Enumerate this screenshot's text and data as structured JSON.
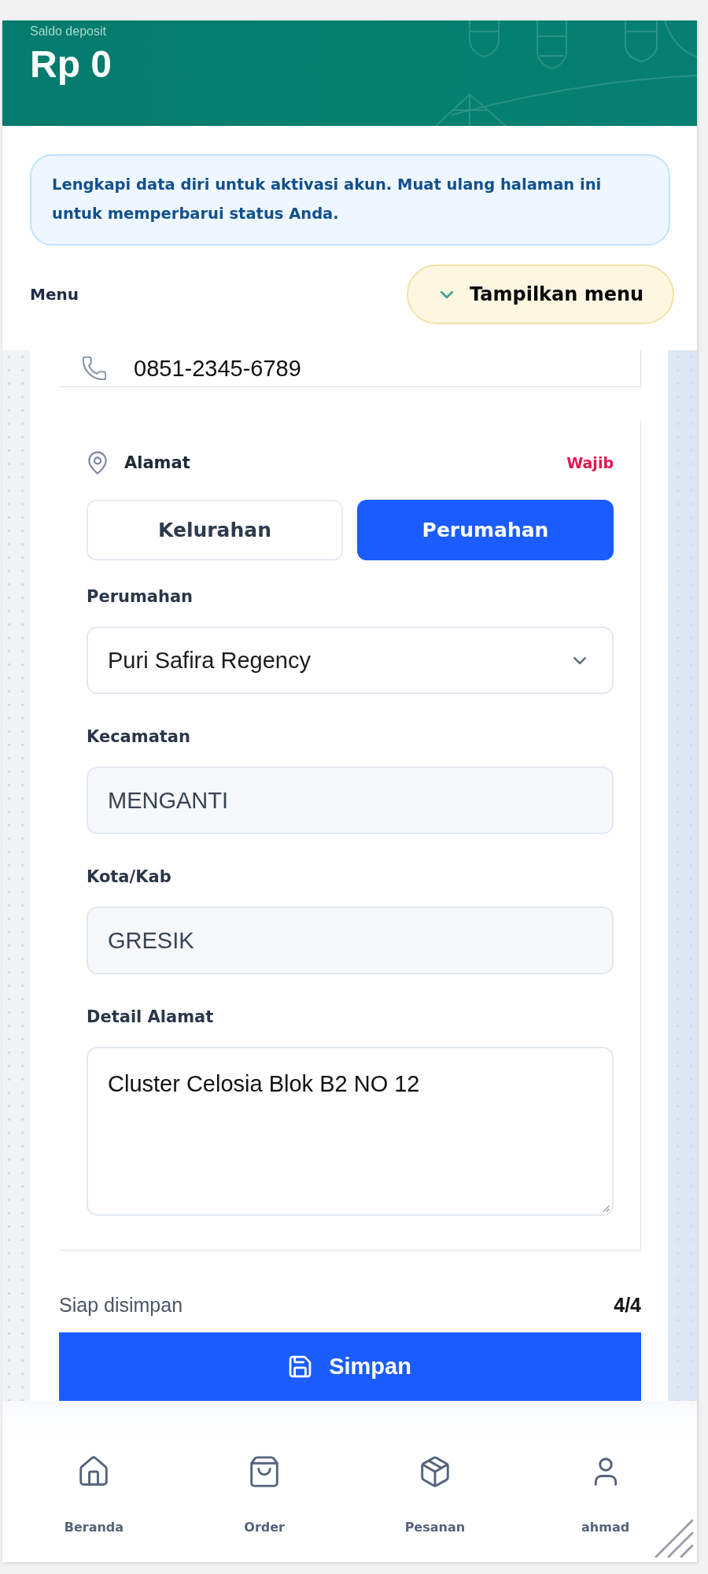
{
  "header": {
    "label": "Saldo deposit",
    "balance": "Rp 0"
  },
  "notice": {
    "text": "Lengkapi data diri untuk aktivasi akun. Muat ulang halaman ini untuk memperbarui status Anda."
  },
  "menu": {
    "label": "Menu",
    "toggle": {
      "label": "Tampilkan menu",
      "expanded": false
    }
  },
  "form": {
    "phone": {
      "value": "0851-2345-6789"
    },
    "address": {
      "title": "Alamat",
      "badge": "Wajib",
      "modes": [
        {
          "label": "Kelurahan",
          "selected": false
        },
        {
          "label": "Perumahan",
          "selected": true
        }
      ],
      "fields": [
        {
          "kind": "select",
          "label": "Perumahan",
          "value": "Puri Safira Regency"
        },
        {
          "kind": "readonly",
          "label": "Kecamatan",
          "value": "MENGANTI"
        },
        {
          "kind": "readonly",
          "label": "Kota/Kab",
          "value": "GRESIK"
        },
        {
          "kind": "textarea",
          "label": "Detail Alamat",
          "value": "Cluster Celosia Blok B2 NO 12"
        }
      ]
    }
  },
  "footer": {
    "status": "Siap disimpan",
    "progress": "4/4",
    "button": "Simpan"
  },
  "bottom_nav": [
    {
      "label": "Beranda",
      "selected": false
    },
    {
      "label": "Order",
      "selected": false
    },
    {
      "label": "Pesanan",
      "selected": false
    },
    {
      "label": "ahmad",
      "selected": false
    }
  ]
}
